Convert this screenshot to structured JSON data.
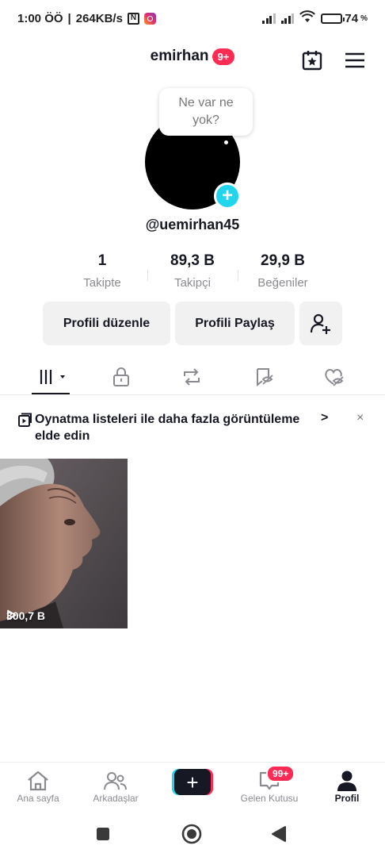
{
  "status_bar": {
    "time": "1:00 ÖÖ",
    "speed": "264KB/s",
    "battery_percent": "74",
    "battery_unit": "%",
    "battery_level": 0.74,
    "icons": [
      "nfc-icon",
      "instagram-icon",
      "signal-icon",
      "signal-icon",
      "wifi-icon",
      "battery-icon"
    ]
  },
  "header": {
    "username": "emirhan",
    "notification_badge": "9+",
    "icons": [
      "calendar-star-icon",
      "menu-icon"
    ]
  },
  "profile": {
    "bubble_text": "Ne var ne yok?",
    "handle": "@uemirhan45",
    "stats": [
      {
        "value": "1",
        "label": "Takipte"
      },
      {
        "value": "89,3 B",
        "label": "Takipçi"
      },
      {
        "value": "29,9 B",
        "label": "Beğeniler"
      }
    ],
    "actions": {
      "edit_label": "Profili düzenle",
      "share_label": "Profili Paylaş"
    }
  },
  "tabs": [
    "grid-icon",
    "lock-icon",
    "repost-icon",
    "favorites-icon",
    "liked-icon"
  ],
  "banner": {
    "text": "Oynatma listeleri ile daha fazla görüntüleme elde edin",
    "arrow": ">",
    "close": "×"
  },
  "videos": [
    {
      "views": "300,7 B"
    }
  ],
  "bottom_nav": {
    "items": [
      {
        "label": "Ana sayfa"
      },
      {
        "label": "Arkadaşlar"
      },
      {
        "label": "+"
      },
      {
        "label": "Gelen Kutusu"
      },
      {
        "label": "Profil"
      }
    ],
    "inbox_badge": "99+"
  },
  "colors": {
    "accent_red": "#fe2c55",
    "accent_cyan": "#20d5ec",
    "text_primary": "#161823",
    "text_secondary": "#8a8b91"
  }
}
